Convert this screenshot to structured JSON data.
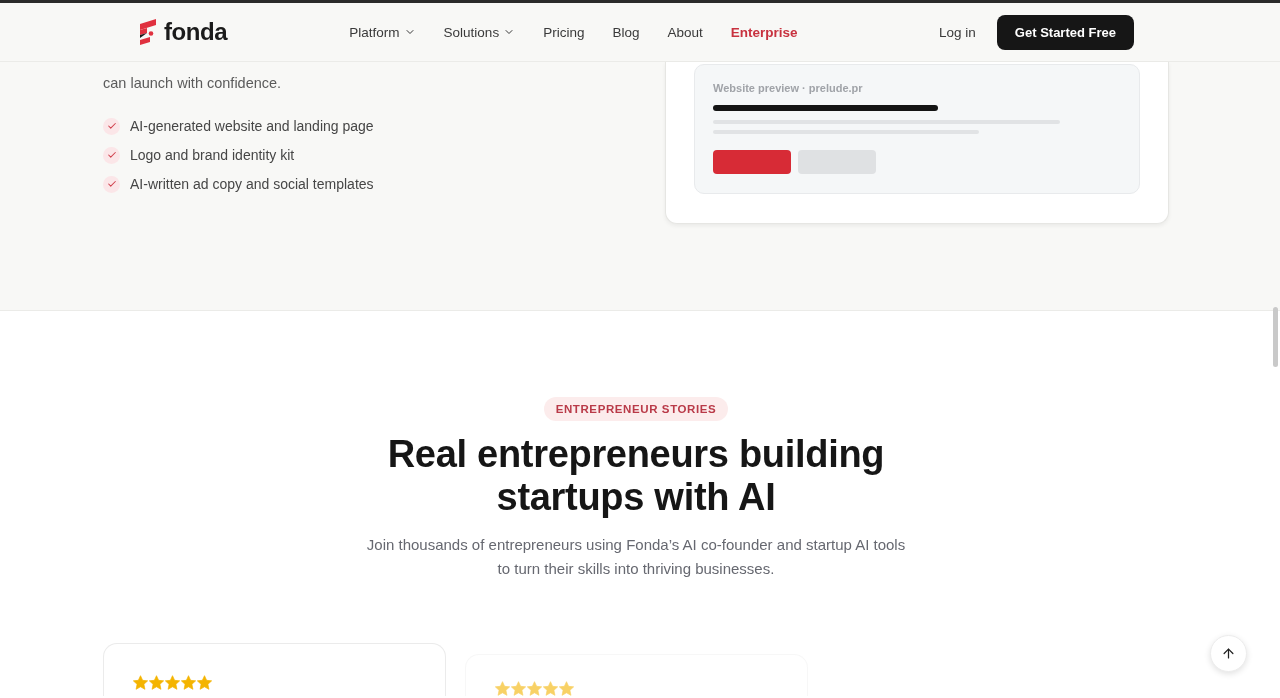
{
  "nav": {
    "logo": "fonda",
    "items": [
      {
        "label": "Platform",
        "kind": "dropdown"
      },
      {
        "label": "Solutions",
        "kind": "dropdown"
      },
      {
        "label": "Pricing",
        "kind": "link"
      },
      {
        "label": "Blog",
        "kind": "link"
      },
      {
        "label": "About",
        "kind": "link"
      },
      {
        "label": "Enterprise",
        "kind": "highlight"
      }
    ],
    "login": "Log in",
    "cta": "Get Started Free"
  },
  "feature": {
    "paragraph": "can launch with confidence.",
    "checklist": [
      "AI-generated website and landing page",
      "Logo and brand identity kit",
      "AI-written ad copy and social templates"
    ],
    "preview": {
      "caption": "Website preview · prelude.pr"
    }
  },
  "stories": {
    "badge": "ENTREPRENEUR STORIES",
    "title": "Real entrepreneurs building startups with AI",
    "subtitle": "Join thousands of entrepreneurs using Fonda’s AI co-founder and startup AI tools to turn their skills into thriving businesses.",
    "testimonials": [
      {
        "stars": 5,
        "faded": false
      },
      {
        "stars": 5,
        "faded": true
      }
    ]
  }
}
